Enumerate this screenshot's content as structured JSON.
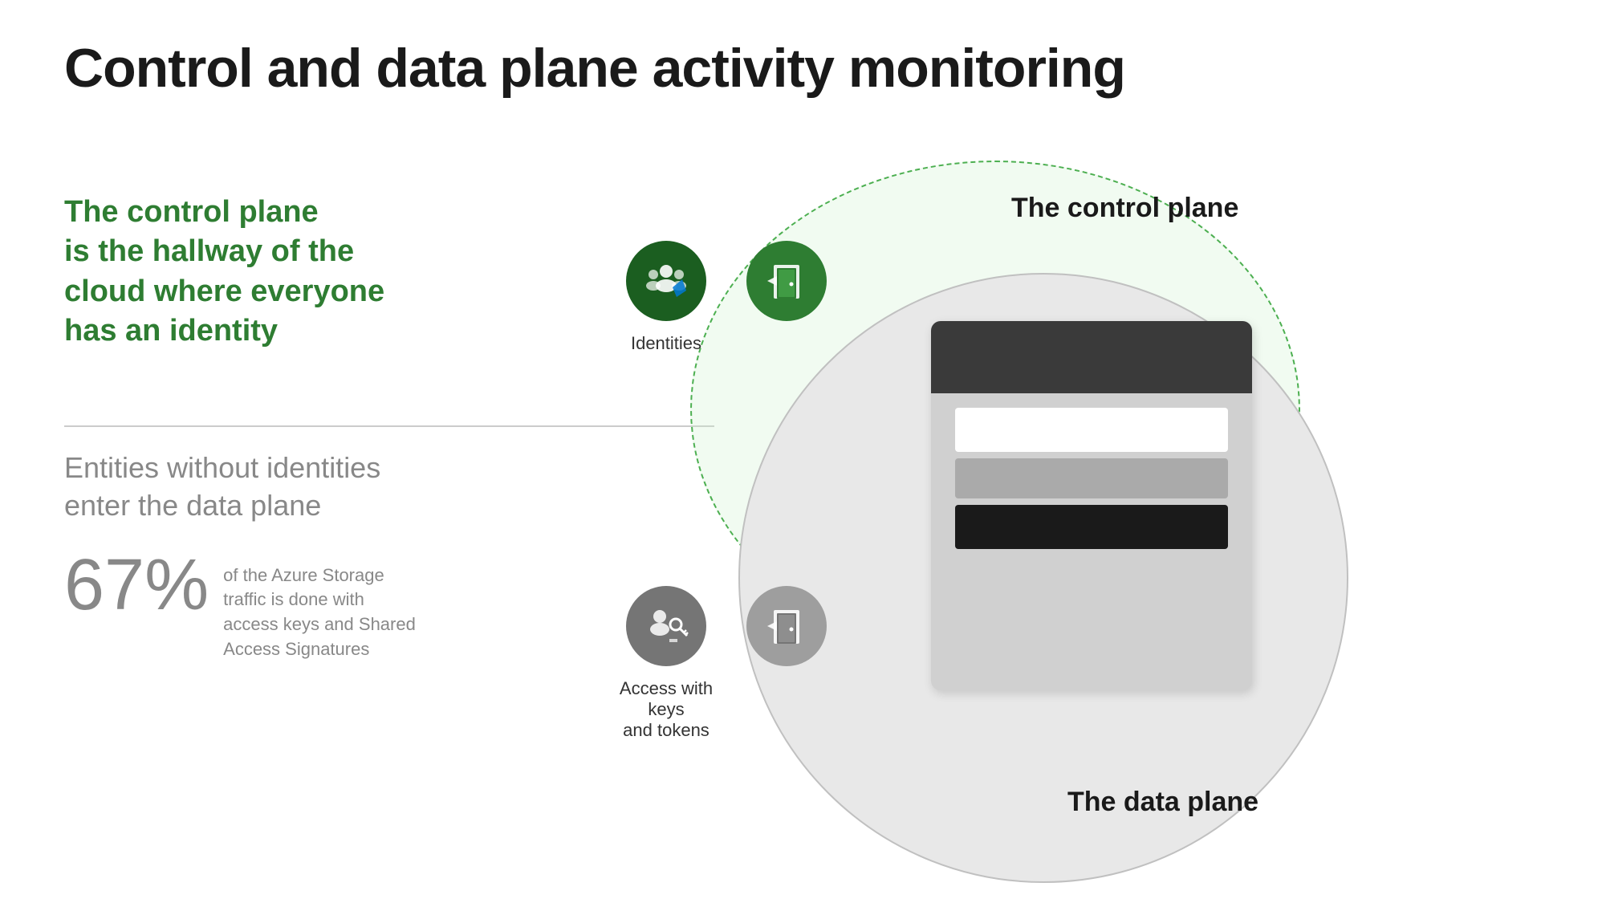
{
  "page": {
    "title": "Control and data plane activity monitoring",
    "background": "#ffffff"
  },
  "left_panel": {
    "green_heading_line1": "The control plane",
    "green_heading_line2": "is the hallway of the",
    "green_heading_line3": "cloud where everyone",
    "green_heading_line4": "has an identity",
    "gray_text_line1": "Entities without identities",
    "gray_text_line2": "enter the data plane",
    "stat_number": "67%",
    "stat_description": "of the Azure Storage traffic is done with access keys and Shared Access Signatures"
  },
  "diagram": {
    "control_plane_label": "The control plane",
    "data_plane_label": "The data plane",
    "identities_label": "Identities",
    "access_keys_label": "Access with keys\nand tokens"
  }
}
